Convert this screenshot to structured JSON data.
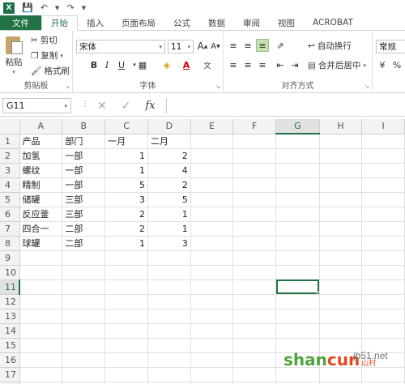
{
  "app": {
    "logo": "X"
  },
  "tabs": [
    "文件",
    "开始",
    "插入",
    "页面布局",
    "公式",
    "数据",
    "审阅",
    "视图",
    "ACROBAT"
  ],
  "clipboard": {
    "paste": "粘贴",
    "cut": "剪切",
    "copy": "复制",
    "format_painter": "格式刷",
    "label": "剪贴板"
  },
  "font": {
    "name": "宋体",
    "size": "11",
    "bold": "B",
    "italic": "I",
    "underline": "U",
    "grow": "A",
    "shrink": "A",
    "label": "字体"
  },
  "alignment": {
    "wrap": "自动换行",
    "merge": "合并后居中",
    "label": "对齐方式"
  },
  "number": {
    "format": "常规"
  },
  "formula_bar": {
    "name_box": "G11",
    "fx": "fx",
    "value": ""
  },
  "columns": [
    "A",
    "B",
    "C",
    "D",
    "E",
    "F",
    "G",
    "H",
    "I"
  ],
  "selected_col": "G",
  "selected_row": "11",
  "rows": [
    [
      "产品",
      "部门",
      "一月",
      "二月",
      "",
      "",
      "",
      "",
      ""
    ],
    [
      "加氢",
      "一部",
      "1",
      "2",
      "",
      "",
      "",
      "",
      ""
    ],
    [
      "螺纹",
      "一部",
      "1",
      "4",
      "",
      "",
      "",
      "",
      ""
    ],
    [
      "精制",
      "一部",
      "5",
      "2",
      "",
      "",
      "",
      "",
      ""
    ],
    [
      "储罐",
      "三部",
      "3",
      "5",
      "",
      "",
      "",
      "",
      ""
    ],
    [
      "反应釜",
      "三部",
      "2",
      "1",
      "",
      "",
      "",
      "",
      ""
    ],
    [
      "四合一",
      "二部",
      "2",
      "1",
      "",
      "",
      "",
      "",
      ""
    ],
    [
      "球罐",
      "二部",
      "1",
      "3",
      "",
      "",
      "",
      "",
      ""
    ],
    [
      "",
      "",
      "",
      "",
      "",
      "",
      "",
      "",
      ""
    ],
    [
      "",
      "",
      "",
      "",
      "",
      "",
      "",
      "",
      ""
    ],
    [
      "",
      "",
      "",
      "",
      "",
      "",
      "",
      "",
      ""
    ],
    [
      "",
      "",
      "",
      "",
      "",
      "",
      "",
      "",
      ""
    ],
    [
      "",
      "",
      "",
      "",
      "",
      "",
      "",
      "",
      ""
    ],
    [
      "",
      "",
      "",
      "",
      "",
      "",
      "",
      "",
      ""
    ],
    [
      "",
      "",
      "",
      "",
      "",
      "",
      "",
      "",
      ""
    ],
    [
      "",
      "",
      "",
      "",
      "",
      "",
      "",
      "",
      ""
    ],
    [
      "",
      "",
      "",
      "",
      "",
      "",
      "",
      "",
      ""
    ],
    [
      "",
      "",
      "",
      "",
      "",
      "",
      "",
      "",
      ""
    ]
  ],
  "watermark": {
    "brand_a": "shan",
    "brand_b": "cun",
    "sub": "山村",
    "site": "jb51.net"
  }
}
